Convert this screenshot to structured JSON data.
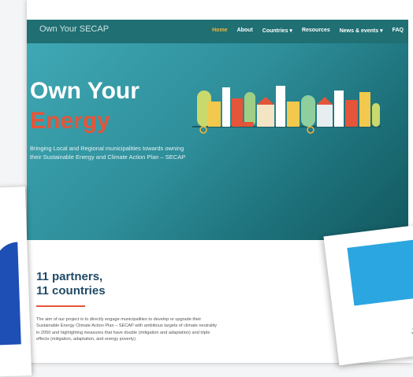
{
  "brand": "Own Your SECAP",
  "nav": [
    "Home",
    "About",
    "Countries ▾",
    "Resources",
    "News & events ▾",
    "FAQ"
  ],
  "hero": {
    "title_line1": "Own Your",
    "title_line2": "Energy",
    "subtitle": "Bringing Local and Regional municipalities towards owning their Sustainable Energy and Climate Action Plan – SECAP"
  },
  "section": {
    "heading_line1": "11 partners,",
    "heading_line2": "11 countries",
    "paragraph": "The aim of our project is to directly engage municipalities to develop or upgrade their Sustainable Energy Climate Action Plan – SECAP with ambitious targets of climate neutrality in 2050 and highlighting measures that have double (mitigation and adaptation) and triple effects (mitigation, adaptation, and energy poverty)."
  },
  "right_card_letter": "J",
  "colors": {
    "nav": "#1f6f73",
    "accent": "#e4553a",
    "active": "#f2b63a",
    "heading": "#1f4a66"
  }
}
